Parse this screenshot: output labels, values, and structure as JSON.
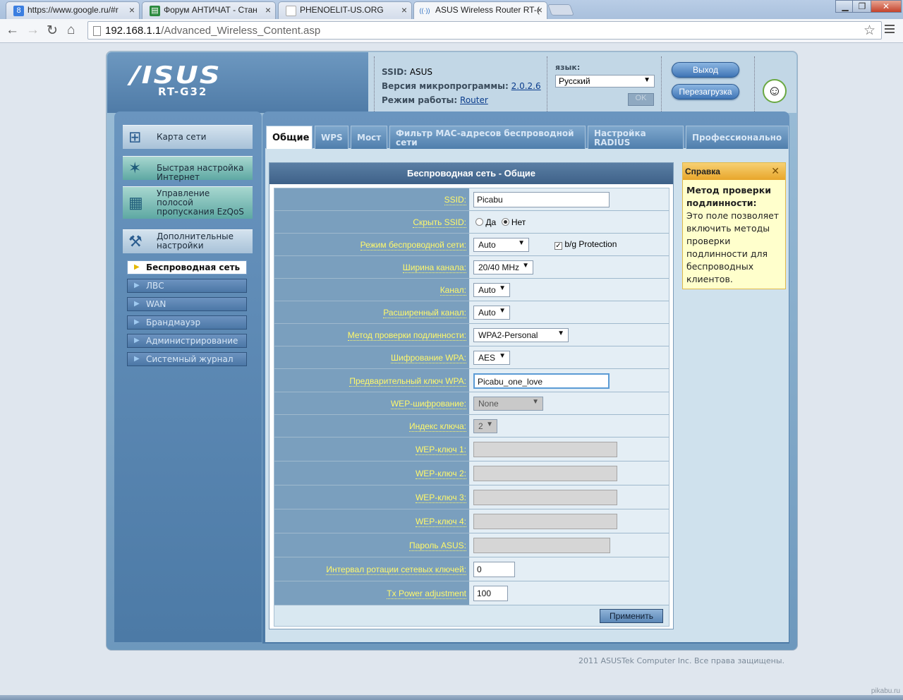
{
  "browser": {
    "tabs": [
      {
        "title": "https://www.google.ru/#r",
        "favicon": "8"
      },
      {
        "title": "Форум АНТИЧАТ - Стан",
        "favicon": "▤"
      },
      {
        "title": "PHENOELIT-US.ORG",
        "favicon": ""
      },
      {
        "title": "ASUS Wireless Router RT-(",
        "favicon": "((·))"
      }
    ],
    "url_host": "192.168.1.1",
    "url_path": "/Advanced_Wireless_Content.asp",
    "win_min": "▁",
    "win_max": "❐",
    "win_close": "✕"
  },
  "header": {
    "logo": "/ISUS",
    "model": "RT-G32",
    "ssid_label": "SSID:",
    "ssid_value": "ASUS",
    "fw_label": "Версия микропрограммы:",
    "fw_value": "2.0.2.6",
    "mode_label": "Режим работы:",
    "mode_value": "Router",
    "lang_label": "язык:",
    "lang_value": "Русский",
    "ok_label": "OK",
    "logout_label": "Выход",
    "reboot_label": "Перезагрузка"
  },
  "sidebar": {
    "main": [
      {
        "label": "Карта сети",
        "icon": "network-map-icon"
      },
      {
        "label": "Быстрая настройка Интернет",
        "icon": "magic-wand-icon"
      },
      {
        "label": "Управление полосой пропускания EzQoS",
        "icon": "qos-icon"
      },
      {
        "label": "Дополнительные настройки",
        "icon": "tools-icon"
      }
    ],
    "sub": [
      {
        "label": "Беспроводная сеть",
        "active": true
      },
      {
        "label": "ЛВС"
      },
      {
        "label": "WAN"
      },
      {
        "label": "Брандмауэр"
      },
      {
        "label": "Администрирование"
      },
      {
        "label": "Системный журнал"
      }
    ]
  },
  "tabs": [
    "Общие",
    "WPS",
    "Мост",
    "Фильтр MAC-адресов беспроводной сети",
    "Настройка RADIUS",
    "Профессионально"
  ],
  "panel_title": "Беспроводная сеть - Общие",
  "form": {
    "ssid": {
      "label": "SSID:",
      "value": "Picabu"
    },
    "hide_ssid": {
      "label": "Скрыть SSID:",
      "yes": "Да",
      "no": "Нет",
      "selected": "Нет"
    },
    "wireless_mode": {
      "label": "Режим беспроводной сети:",
      "value": "Auto",
      "protection": "b/g Protection",
      "protection_checked": true
    },
    "channel_width": {
      "label": "Ширина канала:",
      "value": "20/40 MHz"
    },
    "channel": {
      "label": "Канал:",
      "value": "Auto"
    },
    "ext_channel": {
      "label": "Расширенный канал:",
      "value": "Auto"
    },
    "auth_method": {
      "label": "Метод проверки подлинности:",
      "value": "WPA2-Personal"
    },
    "wpa_encryption": {
      "label": "Шифрование WPA:",
      "value": "AES"
    },
    "wpa_key": {
      "label": "Предварительный ключ WPA:",
      "value": "Picabu_one_love"
    },
    "wep_encryption": {
      "label": "WEP-шифрование:",
      "value": "None"
    },
    "key_index": {
      "label": "Индекс ключа:",
      "value": "2"
    },
    "wep_key1": {
      "label": "WEP-ключ 1:",
      "value": ""
    },
    "wep_key2": {
      "label": "WEP-ключ 2:",
      "value": ""
    },
    "wep_key3": {
      "label": "WEP-ключ 3:",
      "value": ""
    },
    "wep_key4": {
      "label": "WEP-ключ 4:",
      "value": ""
    },
    "asus_password": {
      "label": "Пароль ASUS:",
      "value": ""
    },
    "key_rotation": {
      "label": "Интервал ротации сетевых ключей:",
      "value": "0"
    },
    "tx_power": {
      "label": "Tx Power adjustment",
      "value": "100"
    },
    "apply_label": "Применить"
  },
  "help": {
    "title": "Справка",
    "close": "✕",
    "heading": "Метод проверки подлинности:",
    "text": "Это поле позволяет включить методы проверки подлинности для беспроводных клиентов."
  },
  "footer": "2011 ASUSTek Computer Inc. Все права защищены.",
  "watermark": "pikabu.ru",
  "colors": {
    "accent": "#4c7aa6",
    "label_text": "#fff86a",
    "help_bg": "#ffffcc"
  }
}
